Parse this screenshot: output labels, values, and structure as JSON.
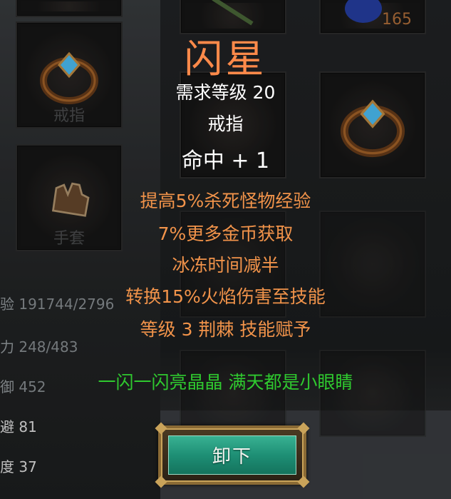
{
  "item": {
    "name": "闪星",
    "requirement": "需求等级 20",
    "type": "戒指",
    "base_stat": "命中 + 1",
    "affixes": [
      "提高5%杀死怪物经验",
      "7%更多金币获取",
      "冰冻时间减半",
      "转换15%火焰伤害至技能",
      "等级 3 荆棘 技能赋予"
    ],
    "flavor": "一闪一闪亮晶晶 满天都是小眼睛"
  },
  "inventory": {
    "potion_count": "165",
    "slot_labels": [
      "戒指",
      "手套"
    ]
  },
  "stats": [
    {
      "label": "验",
      "value": "191744/2796"
    },
    {
      "label": "力",
      "value": "248/483"
    },
    {
      "label": "御",
      "value": "452"
    },
    {
      "label": "避",
      "value": "81"
    },
    {
      "label": "度",
      "value": "37"
    }
  ],
  "actions": {
    "unequip_label": "卸下"
  },
  "colors": {
    "title": "#ff8a4a",
    "affix": "#f1934a",
    "flavor": "#2fc92f",
    "button": "#1e8f75"
  },
  "icons": [
    "ring-icon",
    "glove-icon",
    "potion-icon",
    "weapon-icon"
  ]
}
